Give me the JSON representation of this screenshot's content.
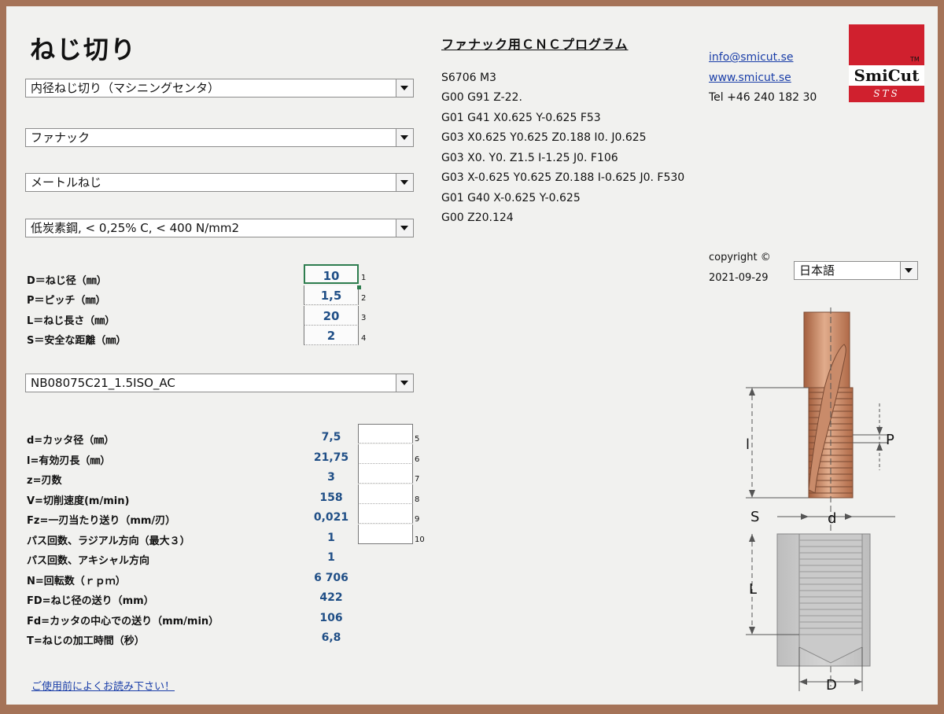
{
  "title": "ねじ切り",
  "dropdowns": {
    "operation": "内径ねじ切り（マシニングセンタ）",
    "control": "ファナック",
    "thread_type": "メートルねじ",
    "material": "低炭素鋼, < 0,25% C, < 400 N/mm2",
    "tool": "NB08075C21_1.5ISO_AC",
    "language": "日本語"
  },
  "inputs": [
    {
      "label": "D＝ねじ径（㎜）",
      "value": "10",
      "row": "1"
    },
    {
      "label": "P＝ピッチ（㎜）",
      "value": "1,5",
      "row": "2"
    },
    {
      "label": "L＝ねじ長さ（㎜）",
      "value": "20",
      "row": "3"
    },
    {
      "label": "S＝安全な距離（㎜）",
      "value": "2",
      "row": "4"
    }
  ],
  "results": [
    {
      "label": "d=カッタ径（㎜）",
      "value": "7,5",
      "row": "5"
    },
    {
      "label": "l=有効刃長（㎜）",
      "value": "21,75",
      "row": "6"
    },
    {
      "label": "z=刃数",
      "value": "3",
      "row": "7"
    },
    {
      "label": "V=切削速度(m/min)",
      "value": "158",
      "row": "8"
    },
    {
      "label": "Fz=一刃当たり送り（mm/刃）",
      "value": "0,021",
      "row": "9"
    },
    {
      "label": "パス回数、ラジアル方向（最大３）",
      "value": "1",
      "row": "10"
    },
    {
      "label": "パス回数、アキシャル方向",
      "value": "1"
    },
    {
      "label": "N=回転数（ｒｐｍ）",
      "value": "6 706"
    },
    {
      "label": "FD=ねじ径の送り（mm）",
      "value": "422"
    },
    {
      "label": "Fd=カッタの中心での送り（mm/min）",
      "value": "106"
    },
    {
      "label": "T=ねじの加工時間（秒）",
      "value": "6,8"
    }
  ],
  "program": {
    "title": "ファナック用ＣＮＣプログラム",
    "lines": [
      "S6706 M3",
      "G00 G91 Z-22.",
      "G01 G41 X0.625 Y-0.625 F53",
      "G03 X0.625 Y0.625 Z0.188 I0. J0.625",
      "G03 X0. Y0. Z1.5 I-1.25 J0. F106",
      "G03 X-0.625 Y0.625 Z0.188 I-0.625 J0. F530",
      "G01 G40 X-0.625 Y-0.625",
      "G00 Z20.124"
    ]
  },
  "contact": {
    "email": "info@smicut.se",
    "web": "www.smicut.se",
    "phone": "Tel +46 240 182 30"
  },
  "logo": {
    "brand": "SmiCut",
    "sub": "STS",
    "tm": "TM"
  },
  "copyright": {
    "label": "copyright ©",
    "date": "2021-09-29"
  },
  "diagram": {
    "l": "l",
    "p": "P",
    "s": "S",
    "d": "d",
    "L": "L",
    "D": "D"
  },
  "warning_link": "ご使用前によくお読み下さい！",
  "colors": {
    "frame": "#a57358",
    "value_blue": "#1f4e86",
    "logo_red": "#d0202e"
  }
}
